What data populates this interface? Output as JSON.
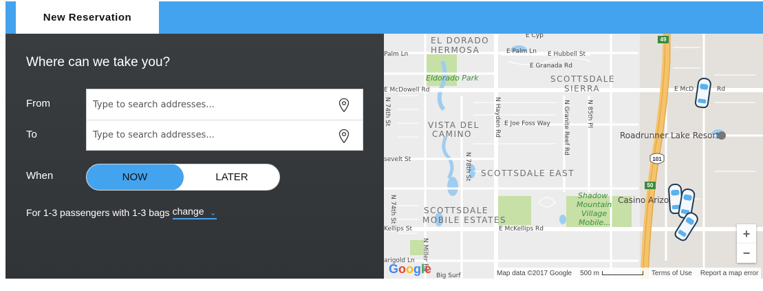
{
  "header": {
    "tab_label": "New Reservation"
  },
  "panel": {
    "title": "Where can we take you?",
    "from_label": "From",
    "to_label": "To",
    "from_placeholder": "Type to search addresses...",
    "to_placeholder": "Type to search addresses...",
    "when_label": "When",
    "when_options": [
      "NOW",
      "LATER"
    ],
    "when_selected": "NOW",
    "passengers_text": "For 1-3 passengers with 1-3 bags",
    "change_label": "change"
  },
  "map": {
    "areas": [
      "EL DORADO",
      "HERMOSA",
      "SCOTTSDALE",
      "SIERRA",
      "VISTA DEL",
      "CAMINO",
      "SCOTTSDALE EAST",
      "SCOTTSDALE",
      "MOBILE ESTATES"
    ],
    "parks": [
      "Eldorado Park",
      "Shadow",
      "Mountain",
      "Village",
      "Mobile..."
    ],
    "roads": [
      "Palm Ln",
      "E Palm Ln",
      "E Hubbell St",
      "E Granada Rd",
      "E McDowell Rd",
      "E McD",
      "Rd",
      "N 74th St",
      "N Hayden Rd",
      "E Joe Foss Way",
      "N Granite Reef Rd",
      "N 85th Pl",
      "N 78th St",
      "sevelt St",
      "N 74th St",
      "Kellips St",
      "E McKellips Rd",
      "N Miller Rd",
      "arigold Ln",
      "Big Surf",
      "E Cyp"
    ],
    "pois": [
      "Roadrunner Lake Resort",
      "Casino Arizo"
    ],
    "highway_shields": [
      "49",
      "101",
      "50"
    ],
    "zoom_in": "+",
    "zoom_out": "−",
    "attribution": {
      "logo": "Google",
      "data": "Map data ©2017 Google",
      "scale": "500 m",
      "terms": "Terms of Use",
      "report": "Report a map error"
    }
  },
  "colors": {
    "accent": "#44a3ee",
    "panel": "#35383b",
    "map_bg": "#ececec",
    "highway": "#f6c36b",
    "park": "#c6e0a6",
    "water": "#9fcdf0"
  }
}
